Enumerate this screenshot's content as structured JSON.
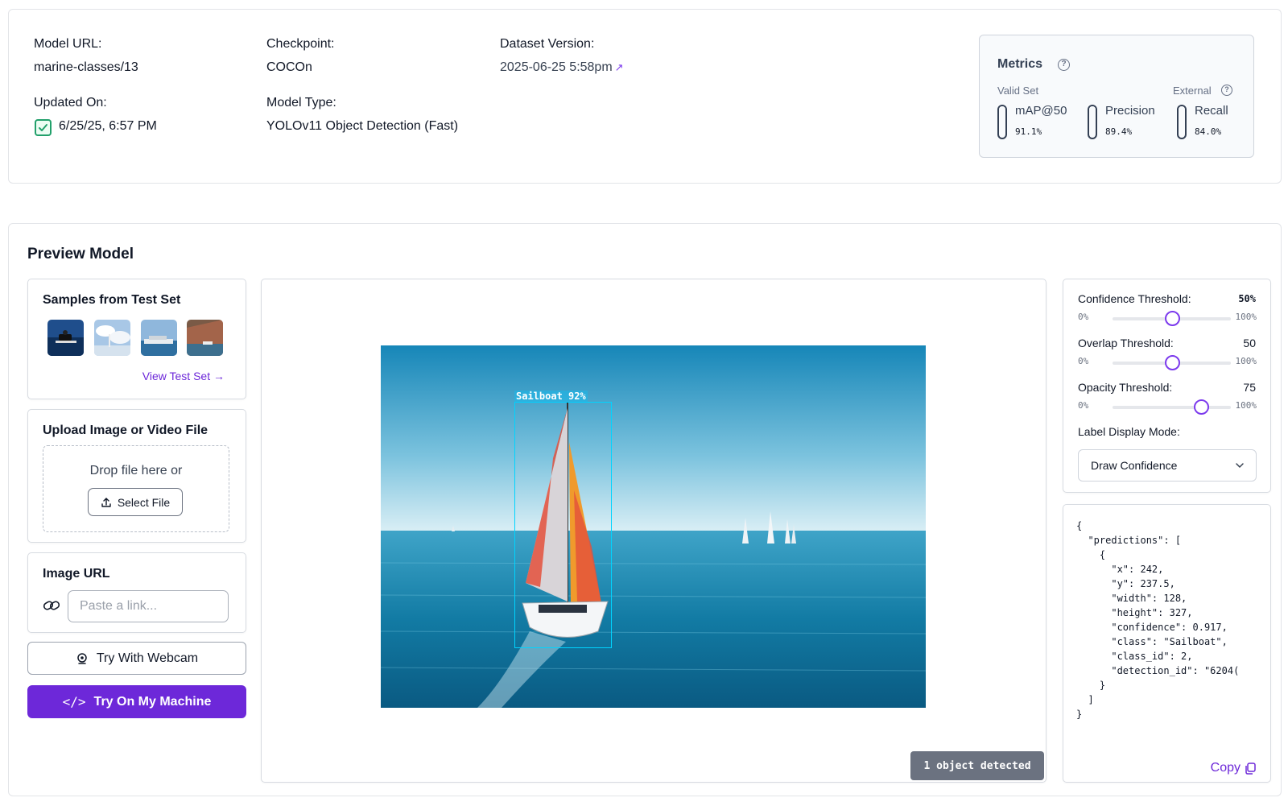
{
  "model_info": {
    "model_url_label": "Model URL:",
    "model_url_value": "marine-classes/13",
    "checkpoint_label": "Checkpoint:",
    "checkpoint_value": "COCOn",
    "dataset_label": "Dataset Version:",
    "dataset_value": "2025-06-25 5:58pm",
    "updated_label": "Updated On:",
    "updated_value": "6/25/25, 6:57 PM",
    "model_type_label": "Model Type:",
    "model_type_value": "YOLOv11 Object Detection (Fast)"
  },
  "metrics": {
    "title": "Metrics",
    "valid_set_label": "Valid Set",
    "external_label": "External",
    "items": [
      {
        "name": "mAP@50",
        "value": "91.1%",
        "fill_fraction": 0.911
      },
      {
        "name": "Precision",
        "value": "89.4%",
        "fill_fraction": 0.894
      },
      {
        "name": "Recall",
        "value": "84.0%",
        "fill_fraction": 0.84
      }
    ]
  },
  "preview": {
    "title": "Preview Model",
    "samples": {
      "title": "Samples from Test Set",
      "view_link": "View Test Set"
    },
    "upload": {
      "title": "Upload Image or Video File",
      "drop_text": "Drop file here or",
      "select_button": "Select File"
    },
    "image_url": {
      "title": "Image URL",
      "placeholder": "Paste a link..."
    },
    "webcam_button": "Try With Webcam",
    "machine_button": "Try On My Machine",
    "detection": {
      "label": "Sailboat 92%",
      "status": "1 object detected"
    },
    "settings": {
      "confidence": {
        "label": "Confidence Threshold:",
        "value": "50%",
        "min": "0%",
        "max": "100%",
        "level": 0.5
      },
      "overlap": {
        "label": "Overlap Threshold:",
        "value": "50",
        "min": "0%",
        "max": "100%",
        "level": 0.5
      },
      "opacity": {
        "label": "Opacity Threshold:",
        "value": "75",
        "min": "0%",
        "max": "100%",
        "level": 0.75
      },
      "label_mode_label": "Label Display Mode:",
      "label_mode_value": "Draw Confidence"
    },
    "json_output": "{\n  \"predictions\": [\n    {\n      \"x\": 242,\n      \"y\": 237.5,\n      \"width\": 128,\n      \"height\": 327,\n      \"confidence\": 0.917,\n      \"class\": \"Sailboat\",\n      \"class_id\": 2,\n      \"detection_id\": \"6204(\n    }\n  ]\n}",
    "copy_label": "Copy"
  },
  "colors": {
    "accent": "#6d28d9",
    "bbox": "#00d4ff",
    "success": "#22a06b"
  }
}
